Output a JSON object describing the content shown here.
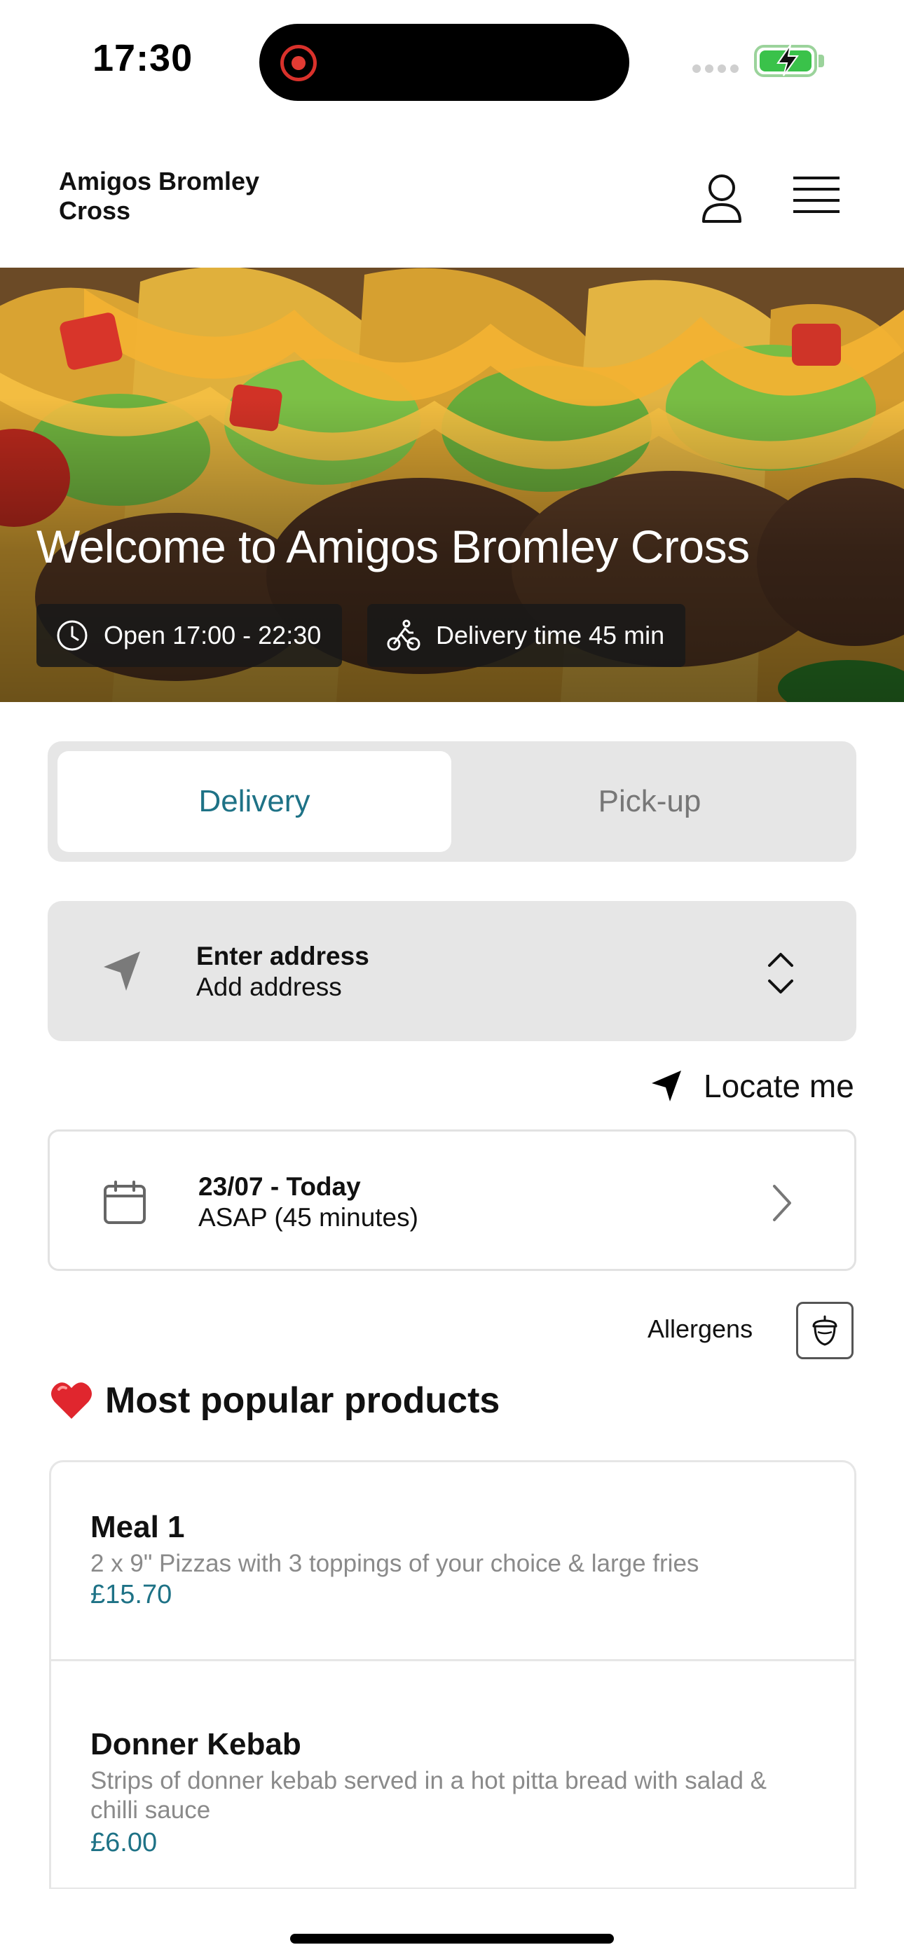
{
  "status_bar": {
    "time": "17:30"
  },
  "header": {
    "store_name": "Amigos Bromley Cross",
    "icons": {
      "profile": "user-icon",
      "menu": "hamburger-menu-icon"
    }
  },
  "hero": {
    "title": "Welcome to Amigos Bromley Cross",
    "open_hours": "Open 17:00 - 22:30",
    "delivery_time": "Delivery time 45 min",
    "icons": {
      "open": "clock-icon",
      "delivery": "bicycle-courier-icon"
    }
  },
  "order_type": {
    "options": [
      "Delivery",
      "Pick-up"
    ],
    "selected": "Delivery",
    "active_color": "#1e7286"
  },
  "address": {
    "title": "Enter address",
    "value": "Add address",
    "icons": {
      "location": "navigation-arrow-icon",
      "toggle": "chevron-up-down-icon"
    }
  },
  "locate": {
    "label": "Locate me",
    "icon": "navigation-arrow-icon"
  },
  "schedule": {
    "date": "23/07 - Today",
    "time": "ASAP (45 minutes)",
    "icons": {
      "calendar": "calendar-icon",
      "chevron": "chevron-right-icon"
    }
  },
  "allergens": {
    "label": "Allergens",
    "icon": "acorn-icon"
  },
  "popular": {
    "heading": "Most popular products",
    "icon": "heart-icon",
    "products": [
      {
        "name": "Meal 1",
        "description": "2 x 9\" Pizzas with 3 toppings of your choice & large fries",
        "price": "£15.70"
      },
      {
        "name": "Donner Kebab",
        "description": "Strips of donner kebab served in a hot pitta bread with salad & chilli sauce",
        "price": "£6.00"
      }
    ]
  },
  "colors": {
    "accent": "#1e7286",
    "card_bg": "#e6e6e6",
    "price": "#1e7286"
  }
}
